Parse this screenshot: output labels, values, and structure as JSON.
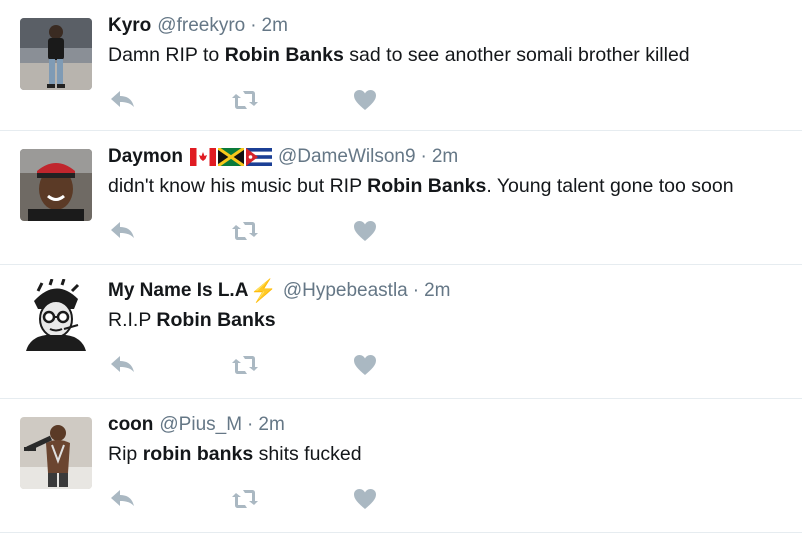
{
  "tweets": [
    {
      "name": "Kyro",
      "handle": "@freekyro",
      "dot": "·",
      "time": "2m",
      "text_before": "Damn RIP to ",
      "text_bold": "Robin Banks",
      "text_after": " sad to see another somali brother killed",
      "avatar_icon": "avatar-photo"
    },
    {
      "name": "Daymon",
      "flags": [
        "canada-flag-icon",
        "jamaica-flag-icon",
        "cuba-flag-icon"
      ],
      "handle": "@DameWilson9",
      "dot": "·",
      "time": "2m",
      "text_before": "didn't know his music but RIP ",
      "text_bold": "Robin Banks",
      "text_after": ". Young talent gone too soon",
      "avatar_icon": "avatar-photo"
    },
    {
      "name": "My Name Is L.A",
      "emoji": "⚡",
      "handle": "@Hypebeastla",
      "dot": "·",
      "time": "2m",
      "text_before": "R.I.P ",
      "text_bold": "Robin Banks",
      "text_after": "",
      "avatar_icon": "avatar-illustration"
    },
    {
      "name": "coon",
      "handle": "@Pius_M",
      "dot": "·",
      "time": "2m",
      "text_before": "Rip ",
      "text_bold": "robin banks",
      "text_after": " shits fucked",
      "avatar_icon": "avatar-photo"
    }
  ],
  "actions": {
    "reply_icon": "reply-icon",
    "retweet_icon": "retweet-icon",
    "like_icon": "heart-icon"
  },
  "colors": {
    "icon": "#aab8c2",
    "muted_text": "#657786",
    "divider": "#e6ecf0",
    "bolt": "#f5a623"
  }
}
